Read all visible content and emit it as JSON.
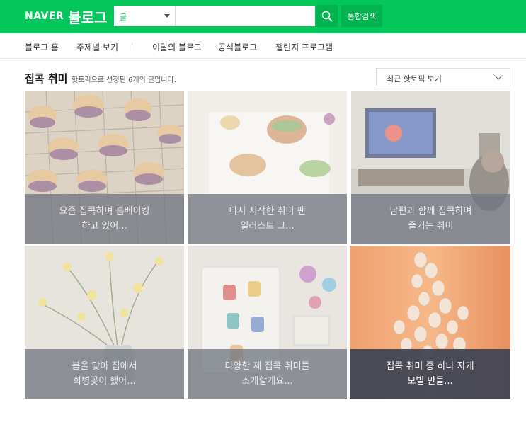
{
  "header": {
    "logo_naver": "NAVER",
    "logo_blog": "블로그",
    "search_scope": "글",
    "search_placeholder": "",
    "search_button_icon": "search-icon",
    "total_search_label": "통합검색",
    "brand_color": "#03c75a"
  },
  "nav": {
    "items": [
      {
        "label": "블로그 홈"
      },
      {
        "label": "주제별 보기"
      },
      {
        "label": "이달의 블로그"
      },
      {
        "label": "공식블로그"
      },
      {
        "label": "챌린지 프로그램"
      }
    ]
  },
  "section": {
    "title": "집콕 취미",
    "subtitle": "핫토픽으로 선정된 6개의 글입니다.",
    "sort_label": "최근 핫토픽 보기"
  },
  "cards": [
    {
      "caption": "요즘 집콕하며 홈베이킹 하고 있어..."
    },
    {
      "caption": "다시 시작한 취미 펜 일러스트 그..."
    },
    {
      "caption": "남편과 함께 집콕하며 즐기는 취미"
    },
    {
      "caption": "봄을 맞아 집에서 화병꽂이 했어..."
    },
    {
      "caption": "다양한 제 집콕 취미들 소개할게요..."
    },
    {
      "caption": "집콕 취미 중 하나 자개 모빌 만들..."
    }
  ],
  "highlight_color": "#e8101c"
}
